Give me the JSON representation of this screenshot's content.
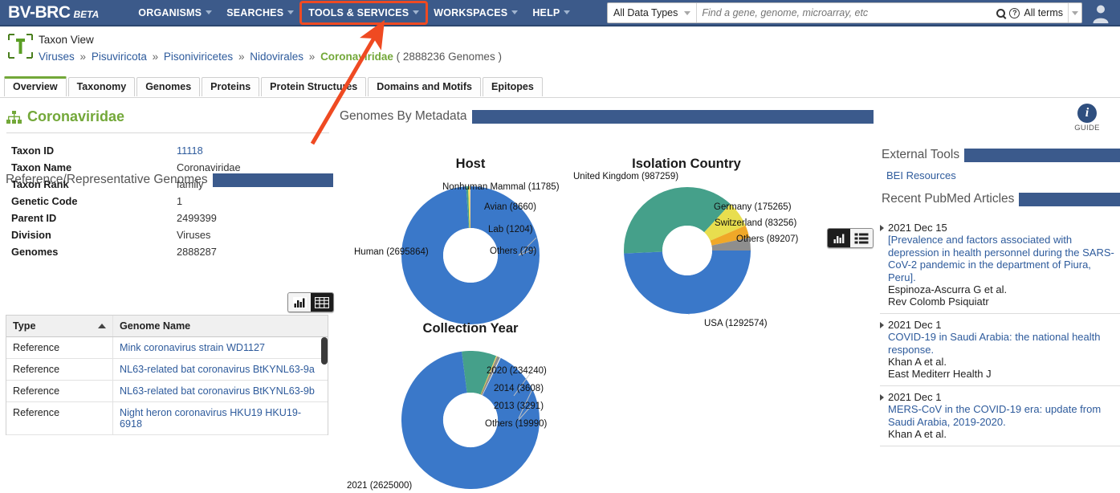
{
  "topnav": {
    "brand": "BV-BRC",
    "brand_beta": "BETA",
    "menu": [
      {
        "label": "ORGANISMS",
        "name": "menu-organisms"
      },
      {
        "label": "SEARCHES",
        "name": "menu-searches"
      },
      {
        "label": "TOOLS & SERVICES",
        "name": "menu-tools-services"
      },
      {
        "label": "WORKSPACES",
        "name": "menu-workspaces"
      },
      {
        "label": "HELP",
        "name": "menu-help"
      }
    ],
    "search": {
      "datatype": "All Data Types",
      "placeholder": "Find a gene, genome, microarray, etc",
      "value": "",
      "terms": "All terms"
    },
    "highlight_color": "#ef4a22",
    "bar_color": "#3c5a8a"
  },
  "taxon_header": {
    "view_label": "Taxon View",
    "breadcrumb": [
      {
        "label": "Viruses",
        "type": "link"
      },
      {
        "label": "Pisuviricota",
        "type": "link"
      },
      {
        "label": "Pisoniviricetes",
        "type": "link"
      },
      {
        "label": "Nidovirales",
        "type": "link"
      },
      {
        "label": "Coronaviridae",
        "type": "current"
      }
    ],
    "separator": "»",
    "genome_count": "( 2888236 Genomes )"
  },
  "tabs": [
    {
      "label": "Overview",
      "active": true
    },
    {
      "label": "Taxonomy",
      "active": false
    },
    {
      "label": "Genomes",
      "active": false
    },
    {
      "label": "Proteins",
      "active": false
    },
    {
      "label": "Protein Structures",
      "active": false
    },
    {
      "label": "Domains and Motifs",
      "active": false
    },
    {
      "label": "Epitopes",
      "active": false
    }
  ],
  "left_panel": {
    "title": "Coronaviridae",
    "facts": [
      {
        "key": "Taxon ID",
        "value": "11118",
        "link": true
      },
      {
        "key": "Taxon Name",
        "value": "Coronaviridae",
        "link": false
      },
      {
        "key": "Taxon Rank",
        "value": "family",
        "link": false
      },
      {
        "key": "Genetic Code",
        "value": "1",
        "link": false
      },
      {
        "key": "Parent ID",
        "value": "2499399",
        "link": false
      },
      {
        "key": "Division",
        "value": "Viruses",
        "link": false
      },
      {
        "key": "Genomes",
        "value": "2888287",
        "link": false
      }
    ],
    "ref_section_title": "Reference/Representative Genomes",
    "view_toggle": {
      "chart": "chart-view",
      "table": "table-view",
      "selected": "table"
    },
    "genome_table": {
      "columns": [
        "Type",
        "Genome Name"
      ],
      "sorted_column": "Type",
      "sort_direction": "asc",
      "rows": [
        {
          "type": "Reference",
          "name": "Mink coronavirus strain WD1127"
        },
        {
          "type": "Reference",
          "name": "NL63-related bat coronavirus BtKYNL63-9a"
        },
        {
          "type": "Reference",
          "name": "NL63-related bat coronavirus BtKYNL63-9b"
        },
        {
          "type": "Reference",
          "name": "Night heron coronavirus HKU19 HKU19-6918"
        }
      ]
    }
  },
  "center": {
    "section_title": "Genomes By Metadata",
    "view_toggle": {
      "chart": "chart-view",
      "table": "table-view",
      "selected": "chart"
    }
  },
  "right_panel": {
    "guide_label": "GUIDE",
    "external_tools_title": "External Tools",
    "external_tools": [
      {
        "label": "BEI Resources"
      }
    ],
    "pubmed_title": "Recent PubMed Articles",
    "articles": [
      {
        "date": "2021 Dec 15",
        "title": "[Prevalence and factors associated with depression in health personnel during the SARS-CoV-2 pandemic in the department of Piura, Peru].",
        "authors": "Espinoza-Ascurra G et al.",
        "journal": "Rev Colomb Psiquiatr"
      },
      {
        "date": "2021 Dec 1",
        "title": "COVID-19 in Saudi Arabia: the national health response.",
        "authors": "Khan A et al.",
        "journal": "East Mediterr Health J"
      },
      {
        "date": "2021 Dec 1",
        "title": "MERS-CoV in the COVID-19 era: update from Saudi Arabia, 2019-2020.",
        "authors": "Khan A et al.",
        "journal": ""
      }
    ]
  },
  "annotation": {
    "arrow_color": "#ef4a22",
    "points_to": "TOOLS & SERVICES"
  },
  "chart_data": [
    {
      "type": "pie",
      "variant": "donut",
      "title": "Host",
      "categories": [
        "Human",
        "Nonhuman Mammal",
        "Avian",
        "Lab",
        "Others"
      ],
      "values": [
        2695864,
        11785,
        8660,
        1204,
        79
      ],
      "labels": [
        "Human (2695864)",
        "Nonhuman Mammal (11785)",
        "Avian (8660)",
        "Lab (1204)",
        "Others (79)"
      ],
      "colors": [
        "#3a78c9",
        "#45a08a",
        "#e8de4e",
        "#f0a828",
        "#8e8e8e"
      ],
      "legend": "labeled-callouts"
    },
    {
      "type": "pie",
      "variant": "donut",
      "title": "Isolation Country",
      "categories": [
        "USA",
        "United Kingdom",
        "Germany",
        "Switzerland",
        "Others"
      ],
      "values": [
        1292574,
        987259,
        175265,
        83256,
        89207
      ],
      "labels": [
        "USA (1292574)",
        "United Kingdom (987259)",
        "Germany (175265)",
        "Switzerland (83256)",
        "Others (89207)"
      ],
      "colors": [
        "#3a78c9",
        "#45a08a",
        "#e8de4e",
        "#f0a828",
        "#8e8e8e"
      ],
      "legend": "labeled-callouts"
    },
    {
      "type": "pie",
      "variant": "donut",
      "title": "Collection Year",
      "categories": [
        "2021",
        "2020",
        "2014",
        "2013",
        "Others"
      ],
      "values": [
        2630000,
        234240,
        3608,
        3291,
        19990
      ],
      "labels": [
        "2021 (2625000)",
        "2020 (234240)",
        "2014 (3608)",
        "2013 (3291)",
        "Others (19990)"
      ],
      "colors": [
        "#3a78c9",
        "#45a08a",
        "#e8de4e",
        "#f0a828",
        "#8e8e8e"
      ],
      "legend": "labeled-callouts"
    }
  ]
}
